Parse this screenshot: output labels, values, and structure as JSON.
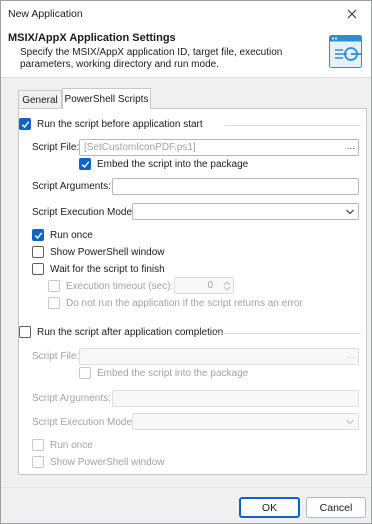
{
  "window": {
    "title": "New Application"
  },
  "header": {
    "title": "MSIX/AppX Application Settings",
    "description": "Specify the MSIX/AppX application ID, target file, execution parameters, working directory and run mode."
  },
  "tabs": [
    {
      "label": "General",
      "active": false
    },
    {
      "label": "PowerShell Scripts",
      "active": true
    }
  ],
  "before_start": {
    "checkbox_label": "Run the script before application start",
    "checked": true,
    "script_file_label": "Script File:",
    "script_file_value": "[SetCustomIconPDF.ps1]",
    "browse_label": "...",
    "embed_label": "Embed the script into the package",
    "embed_checked": true,
    "arguments_label": "Script Arguments:",
    "arguments_value": "",
    "mode_label": "Script Execution Mode:",
    "mode_value": "",
    "run_once_label": "Run once",
    "run_once_checked": true,
    "show_window_label": "Show PowerShell window",
    "show_window_checked": false,
    "wait_label": "Wait for the script to finish",
    "wait_checked": false,
    "timeout_label": "Execution timeout (sec):",
    "timeout_value": "0",
    "timeout_checked": false,
    "no_run_label": "Do not run the application if the script returns an error",
    "no_run_checked": false
  },
  "after_completion": {
    "checkbox_label": "Run the script after application completion",
    "checked": false,
    "script_file_label": "Script File:",
    "script_file_value": "",
    "browse_label": "...",
    "embed_label": "Embed the script into the package",
    "arguments_label": "Script Arguments:",
    "mode_label": "Script Execution Mode:",
    "run_once_label": "Run once",
    "show_window_label": "Show PowerShell window"
  },
  "footer": {
    "ok_label": "OK",
    "cancel_label": "Cancel"
  },
  "colors": {
    "accent": "#0a64c8",
    "disabled_text": "#a2a2a2"
  },
  "icons": {
    "close": "close-icon",
    "header": "msix-app-icon",
    "checkmark": "checkmark-icon",
    "dropdown": "chevron-down-icon",
    "spin": "spin-arrows-icon"
  }
}
